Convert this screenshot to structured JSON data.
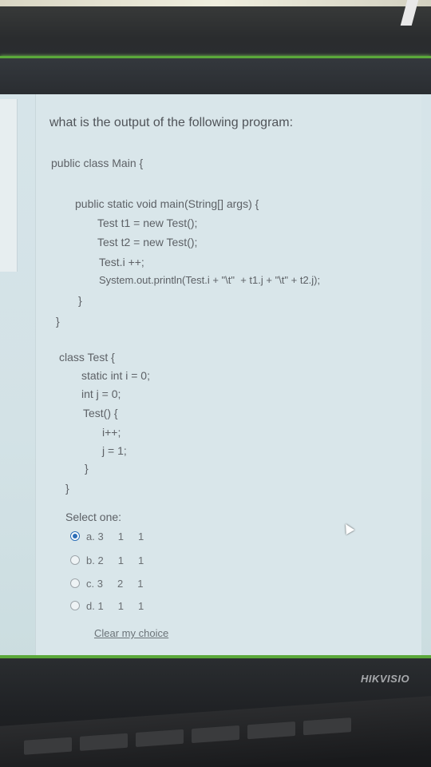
{
  "question": {
    "prompt": "what is the output of the following program:",
    "code_lines": [
      "public class Main {",
      "public static void main(String[] args) {",
      "Test t1 = new Test();",
      "Test t2 = new Test();",
      "Test.i ++;",
      "System.out.println(Test.i + \"\\t\"  + t1.j + \"\\t\" + t2.j);",
      "}",
      "}",
      "class Test {",
      "static int i = 0;",
      "int j = 0;",
      "Test() {",
      "i++;",
      "j = 1;",
      "}",
      "}"
    ]
  },
  "answers": {
    "select_label": "Select one:",
    "options": [
      {
        "label": "a. 3     1     1",
        "selected": true
      },
      {
        "label": "b. 2     1     1",
        "selected": false
      },
      {
        "label": "c. 3     2     1",
        "selected": false
      },
      {
        "label": "d. 1     1     1",
        "selected": false
      }
    ],
    "clear_label": "Clear my choice"
  },
  "monitor": {
    "brand": "HIKVISIO"
  },
  "colors": {
    "screen_bg": "#d6e4e9",
    "text": "#5b5f63",
    "radio_selected": "#2d6fb8",
    "bezel_green": "#5aa83a"
  }
}
